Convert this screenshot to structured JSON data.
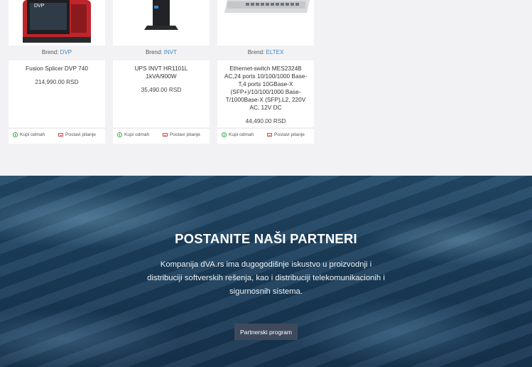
{
  "products": [
    {
      "brand_label": "Brend:",
      "brand": "DVP",
      "title": "Fusion Splicer DVP 740",
      "price": "214,990.00 RSD",
      "image_text": "DVP",
      "image_icon": "fusion-splicer-image"
    },
    {
      "brand_label": "Brend:",
      "brand": "INVT",
      "title": "UPS INVT HR1101L 1kVA/900W",
      "price": "35,490.00 RSD",
      "image_icon": "ups-image"
    },
    {
      "brand_label": "Brend:",
      "brand": "ELTEX",
      "title": "Ethernet-switch MES2324B AC,24 ports 10/100/1000 Base-T,4 ports 10GBase-X (SFP+)/10/100/1000 Base-T/1000Base-X (SFP),L2, 220V AC, 12V DC",
      "price": "44,490.00 RSD",
      "image_icon": "ethernet-switch-image"
    }
  ],
  "actions": {
    "buy": "Kupi odmah",
    "ask": "Postavi pitanje"
  },
  "colors": {
    "brand_link": "#3a84c4",
    "buy_icon": "#3aa94a",
    "ask_icon": "#d44848",
    "hero_bg": "#1c3f5d",
    "button_bg": "#3e4a5c"
  },
  "hero": {
    "title": "POSTANITE NAŠI PARTNERI",
    "text": "Kompanija dVA.rs ima dugogodišnje iskustvo u proizvodnji i distribuciji softverskih rešenja, kao i distribuciji telekomunikacionih i sigurnosnih sistema.",
    "button": "Partnerski program"
  }
}
